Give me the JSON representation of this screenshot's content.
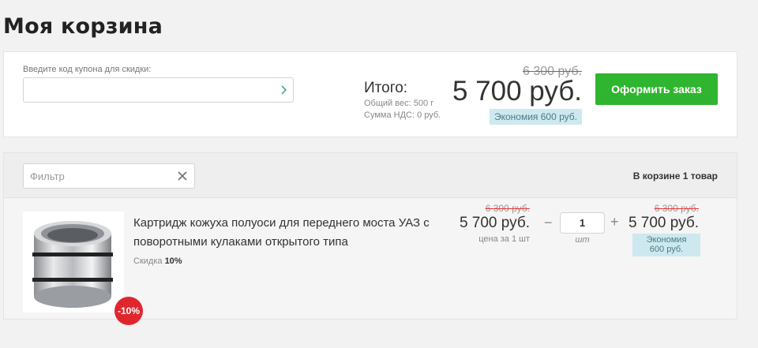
{
  "page_title": "Моя корзина",
  "coupon": {
    "label": "Введите код купона для скидки:",
    "value": "",
    "submit_icon": "chevron-right-icon"
  },
  "totals": {
    "label": "Итого:",
    "weight": "Общий вес: 500 г",
    "vat": "Сумма НДС: 0 руб.",
    "old_price": "6 300 руб.",
    "price": "5 700 руб.",
    "economy": "Экономия 600 руб.",
    "checkout_label": "Оформить заказ",
    "checkout_color": "#2fb52f"
  },
  "cart": {
    "filter_placeholder": "Фильтр",
    "clear_icon": "close-icon",
    "count_text": "В корзине 1 товар",
    "items": [
      {
        "title": "Картридж кожуха полуоси для переднего моста УАЗ с поворотными кулаками открытого типа",
        "discount_label": "Скидка",
        "discount_value": "10%",
        "badge": "-10%",
        "unit_old_price": "6 300 руб.",
        "unit_price": "5 700 руб.",
        "unit_note": "цена за 1 шт",
        "qty_minus": "−",
        "qty": "1",
        "qty_plus": "+",
        "qty_unit": "шт",
        "line_old_price": "6 300 руб.",
        "line_price": "5 700 руб.",
        "line_economy_1": "Экономия",
        "line_economy_2": "600 руб."
      }
    ]
  }
}
